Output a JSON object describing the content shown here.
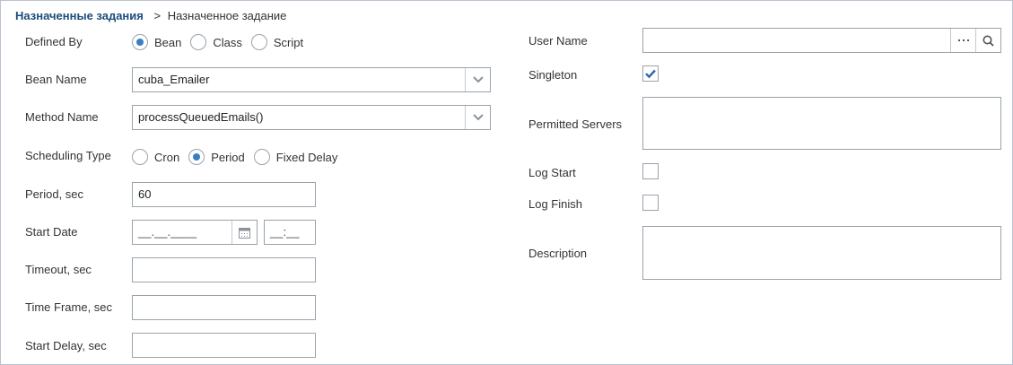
{
  "breadcrumb": {
    "parent": "Назначенные задания",
    "separator": ">",
    "current": "Назначенное задание"
  },
  "form": {
    "defined_by": {
      "label": "Defined By",
      "options": [
        "Bean",
        "Class",
        "Script"
      ],
      "selected": "Bean"
    },
    "bean_name": {
      "label": "Bean Name",
      "value": "cuba_Emailer"
    },
    "method_name": {
      "label": "Method Name",
      "value": "processQueuedEmails()"
    },
    "scheduling_type": {
      "label": "Scheduling Type",
      "options": [
        "Cron",
        "Period",
        "Fixed Delay"
      ],
      "selected": "Period"
    },
    "period": {
      "label": "Period, sec",
      "value": "60"
    },
    "start_date": {
      "label": "Start Date",
      "date_mask": "__.__.____",
      "time_mask": "__:__"
    },
    "timeout": {
      "label": "Timeout, sec",
      "value": ""
    },
    "time_frame": {
      "label": "Time Frame, sec",
      "value": ""
    },
    "start_delay": {
      "label": "Start Delay, sec",
      "value": ""
    },
    "user_name": {
      "label": "User Name",
      "value": ""
    },
    "singleton": {
      "label": "Singleton",
      "checked": true
    },
    "permitted_servers": {
      "label": "Permitted Servers",
      "value": ""
    },
    "log_start": {
      "label": "Log Start",
      "checked": false
    },
    "log_finish": {
      "label": "Log Finish",
      "checked": false
    },
    "description": {
      "label": "Description",
      "value": ""
    }
  },
  "icons": {
    "dropdown": "chevron-down-icon",
    "calendar": "calendar-icon",
    "lookup": "ellipsis-icon",
    "search": "search-icon",
    "check": "checkmark-icon"
  },
  "colors": {
    "accent": "#3a7fc4",
    "breadcrumb_link": "#1c4c7c",
    "border": "#9aa3ab"
  }
}
